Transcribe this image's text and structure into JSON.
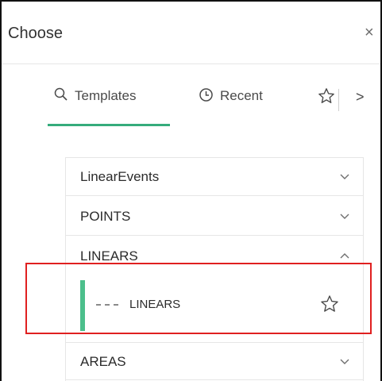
{
  "panel": {
    "title": "Choose",
    "close_glyph": "×"
  },
  "tabs": {
    "items": [
      {
        "label": "Templates",
        "icon": "search-icon",
        "active": true
      },
      {
        "label": "Recent",
        "icon": "clock-icon",
        "active": false
      },
      {
        "label": "",
        "icon": "star-icon",
        "active": false
      }
    ],
    "next_glyph": ">"
  },
  "templates": {
    "groups": [
      {
        "label": "LinearEvents",
        "expanded": false
      },
      {
        "label": "POINTS",
        "expanded": false
      },
      {
        "label": "LINEARS",
        "expanded": true
      },
      {
        "label": "AREAS",
        "expanded": false
      }
    ],
    "linears_items": [
      {
        "swatch": "- - -",
        "label": "LINEARS",
        "icon": "star-icon"
      }
    ]
  },
  "colors": {
    "accent": "#35ac7c",
    "item_bar": "#4cbf8c",
    "highlight": "#e02020",
    "border": "#111111"
  }
}
